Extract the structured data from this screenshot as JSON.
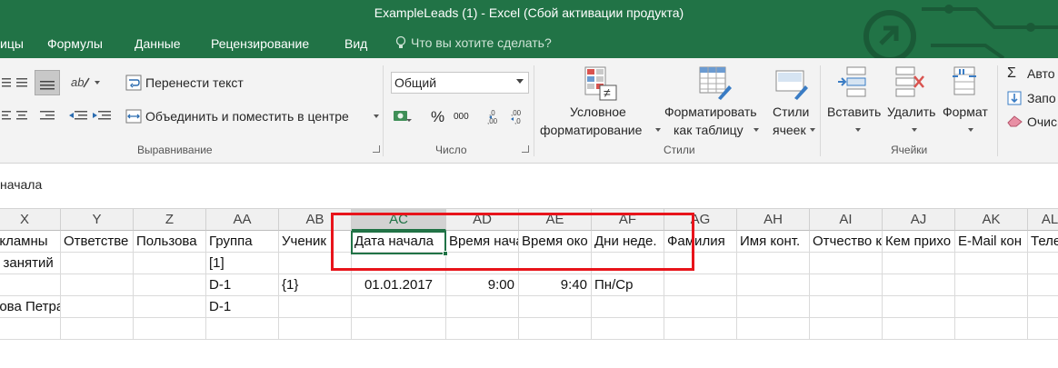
{
  "window": {
    "title": "ExampleLeads (1) - Excel (Сбой активации продукта)"
  },
  "menu": {
    "tabs": [
      "ицы",
      "Формулы",
      "Данные",
      "Рецензирование",
      "Вид"
    ],
    "tell_me": "Что вы хотите сделать?"
  },
  "ribbon": {
    "alignment": {
      "wrap_text": "Перенести текст",
      "merge_center": "Объединить и поместить в центре",
      "group_label": "Выравнивание"
    },
    "number": {
      "format": "Общий",
      "percent": "%",
      "thousands": "000",
      "group_label": "Число"
    },
    "styles": {
      "conditional_line1": "Условное",
      "conditional_line2": "форматирование",
      "format_table_line1": "Форматировать",
      "format_table_line2": "как таблицу",
      "cell_styles_line1": "Стили",
      "cell_styles_line2": "ячеек",
      "group_label": "Стили"
    },
    "cells": {
      "insert": "Вставить",
      "delete": "Удалить",
      "format": "Формат",
      "group_label": "Ячейки"
    },
    "editing": {
      "autosum": "Авто",
      "fill": "Запо",
      "clear": "Очис"
    }
  },
  "formula_bar": {
    "value": "начала"
  },
  "sheet": {
    "columns": [
      "X",
      "Y",
      "Z",
      "AA",
      "AB",
      "AC",
      "AD",
      "AE",
      "AF",
      "AG",
      "AH",
      "AI",
      "AJ",
      "AK",
      "AL"
    ],
    "selected_column": "AC",
    "rows": [
      [
        "екламны",
        "Ответстве",
        "Пользова",
        "Группа",
        "Ученик",
        "Дата начала",
        "Время нача",
        "Время око",
        "Дни неде.",
        "Фамилия",
        "Имя конт.",
        "Отчество к",
        "Кем прихо",
        "E-Mail кон",
        "Теле"
      ],
      [
        "а занятий",
        "",
        "",
        "[1]",
        "",
        "",
        "",
        "",
        "",
        "",
        "",
        "",
        "",
        "",
        ""
      ],
      [
        "",
        "",
        "",
        "D-1",
        "{1}",
        "01.01.2017",
        "9:00",
        "9:40",
        "Пн/Ср",
        "",
        "",
        "",
        "",
        "",
        ""
      ],
      [
        "рова Петра",
        "",
        "",
        "D-1",
        "",
        "",
        "",
        "",
        "",
        "",
        "",
        "",
        "",
        "",
        ""
      ],
      [
        "",
        "",
        "",
        "",
        "",
        "",
        "",
        "",
        "",
        "",
        "",
        "",
        "",
        "",
        ""
      ]
    ]
  }
}
